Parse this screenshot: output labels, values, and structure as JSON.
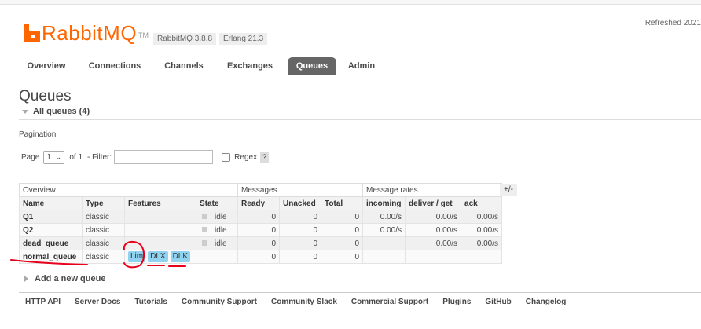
{
  "header": {
    "logo_text": "RabbitMQ",
    "logo_tm": "TM",
    "version": "RabbitMQ 3.8.8",
    "erlang": "Erlang 21.3",
    "refreshed": "Refreshed 2021"
  },
  "nav": {
    "tabs": [
      {
        "label": "Overview"
      },
      {
        "label": "Connections"
      },
      {
        "label": "Channels"
      },
      {
        "label": "Exchanges"
      },
      {
        "label": "Queues"
      },
      {
        "label": "Admin"
      }
    ],
    "active": "Queues"
  },
  "page": {
    "title": "Queues",
    "section_label": "All queues (4)"
  },
  "pagination": {
    "heading": "Pagination",
    "page_label": "Page",
    "page_value": "1",
    "of_label": "of 1",
    "filter_label": "- Filter:",
    "filter_value": "",
    "regex_label": "Regex",
    "help": "?"
  },
  "table": {
    "groups": [
      "Overview",
      "Messages",
      "Message rates"
    ],
    "columns": [
      "Name",
      "Type",
      "Features",
      "State",
      "Ready",
      "Unacked",
      "Total",
      "incoming",
      "deliver / get",
      "ack"
    ],
    "column_selector": "+/-",
    "rows": [
      {
        "name": "Q1",
        "type": "classic",
        "features": [],
        "state": "idle",
        "ready": "0",
        "unacked": "0",
        "total": "0",
        "incoming": "0.00/s",
        "deliver_get": "0.00/s",
        "ack": "0.00/s"
      },
      {
        "name": "Q2",
        "type": "classic",
        "features": [],
        "state": "idle",
        "ready": "0",
        "unacked": "0",
        "total": "0",
        "incoming": "0.00/s",
        "deliver_get": "0.00/s",
        "ack": "0.00/s"
      },
      {
        "name": "dead_queue",
        "type": "classic",
        "features": [],
        "state": "idle",
        "ready": "0",
        "unacked": "0",
        "total": "0",
        "incoming": "",
        "deliver_get": "0.00/s",
        "ack": "0.00/s"
      },
      {
        "name": "normal_queue",
        "type": "classic",
        "features": [
          "Lim",
          "DLX",
          "DLK"
        ],
        "state": "",
        "ready": "0",
        "unacked": "0",
        "total": "0",
        "incoming": "",
        "deliver_get": "",
        "ack": ""
      }
    ]
  },
  "add_queue": "Add a new queue",
  "footer": [
    "HTTP API",
    "Server Docs",
    "Tutorials",
    "Community Support",
    "Community Slack",
    "Commercial Support",
    "Plugins",
    "GitHub",
    "Changelog"
  ],
  "colors": {
    "brand": "#ff6600",
    "tab_active": "#666666",
    "feature_badge": "#8fd3f0",
    "annotation": "#e8001c"
  }
}
